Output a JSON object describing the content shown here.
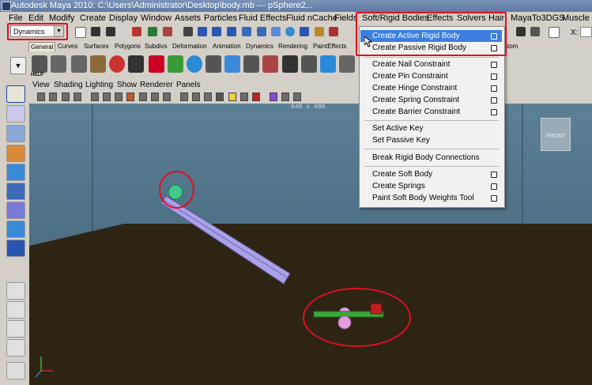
{
  "window": {
    "title": "Autodesk Maya 2010: C:\\Users\\Administrator\\Desktop\\body.mb  ---  pSphere2..."
  },
  "menubar": [
    {
      "label": "File"
    },
    {
      "label": "Edit"
    },
    {
      "label": "Modify"
    },
    {
      "label": "Create"
    },
    {
      "label": "Display"
    },
    {
      "label": "Window"
    },
    {
      "label": "Assets"
    },
    {
      "label": "Particles"
    },
    {
      "label": "Fluid Effects"
    },
    {
      "label": "Fluid nCache"
    },
    {
      "label": "Fields"
    },
    {
      "label": "Soft/Rigid Bodies"
    },
    {
      "label": "Effects"
    },
    {
      "label": "Solvers"
    },
    {
      "label": "Hair"
    },
    {
      "label": "MayaTo3DGS"
    },
    {
      "label": "Muscle"
    }
  ],
  "mode_selector": {
    "value": "Dynamics"
  },
  "xfield_label": "X:",
  "shelf_tabs": [
    "General",
    "Curves",
    "Surfaces",
    "Polygons",
    "Subdivs",
    "Deformation",
    "Animation",
    "Dynamics",
    "Rendering",
    "PaintEffects",
    "stom"
  ],
  "help_label": "HELP",
  "panel_menu": [
    "View",
    "Shading",
    "Lighting",
    "Show",
    "Renderer",
    "Panels"
  ],
  "viewport": {
    "resolution": "640 x 480",
    "cube_label": "FRONT"
  },
  "dropdown": {
    "items": [
      {
        "label": "Create Active Rigid Body",
        "options": true,
        "highlighted": true
      },
      {
        "label": "Create Passive Rigid Body",
        "options": true
      },
      {
        "label": "Create Nail Constraint",
        "options": true
      },
      {
        "label": "Create Pin Constraint",
        "options": true
      },
      {
        "label": "Create Hinge Constraint",
        "options": true
      },
      {
        "label": "Create Spring Constraint",
        "options": true
      },
      {
        "label": "Create Barrier Constraint",
        "options": true
      },
      {
        "label": "Set Active Key",
        "options": false
      },
      {
        "label": "Set Passive Key",
        "options": false
      },
      {
        "label": "Break Rigid Body Connections",
        "options": false
      },
      {
        "label": "Create Soft Body",
        "options": true
      },
      {
        "label": "Create Springs",
        "options": true
      },
      {
        "label": "Paint Soft Body Weights Tool",
        "options": true
      }
    ]
  },
  "colors": {
    "highlight": "#3c7fdf",
    "annotation_red": "#e01020",
    "ramp": "#a8a0e0",
    "sphere_green": "#3fc98a",
    "seesaw_green": "#3aa83a",
    "seesaw_red": "#c02020"
  }
}
